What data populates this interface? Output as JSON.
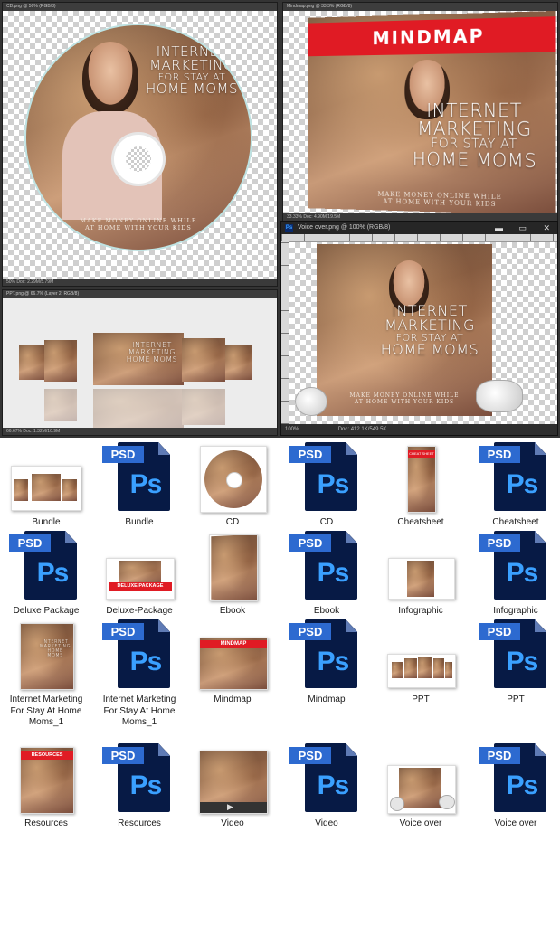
{
  "windows": {
    "cd": {
      "title": "CD.png @ 50% (RGB/8)",
      "status": "50%   Doc: 2.29M/5.79M"
    },
    "mindmap": {
      "title": "Mindmap.png @ 33.3% (RGB/8)",
      "status": "33.33%   Doc: 4.90M/19.5M"
    },
    "bundle": {
      "title": "PPT.png @ 66.7% (Layer 2, RGB/8)",
      "status": "66.67%   Doc: 1.32M/10.9M"
    },
    "voice": {
      "title": "Voice over.png @ 100% (RGB/8)",
      "zoom": "100%",
      "status": "Doc: 412.1K/549.5K"
    }
  },
  "artwork": {
    "title_line1": "INTERNET",
    "title_line2": "MARKETING",
    "title_line3": "FOR STAY AT",
    "title_line4": "HOME MOMS",
    "subtitle_line1": "MAKE MONEY ONLINE WHILE",
    "subtitle_line2": "AT HOME WITH YOUR KIDS",
    "banner_mindmap": "MINDMAP",
    "banner_cheatsheet": "CHEAT SHEET",
    "banner_deluxe": "DELUXE PACKAGE",
    "banner_resources": "RESOURCES"
  },
  "psd_tag": "PSD",
  "ps_glyph": "Ps",
  "files": [
    {
      "label": "Bundle",
      "kind": "bundle"
    },
    {
      "label": "Bundle",
      "kind": "psd"
    },
    {
      "label": "CD",
      "kind": "cd"
    },
    {
      "label": "CD",
      "kind": "psd"
    },
    {
      "label": "Cheatsheet",
      "kind": "cheatsheet"
    },
    {
      "label": "Cheatsheet",
      "kind": "psd"
    },
    {
      "label": "Deluxe Package",
      "kind": "psd"
    },
    {
      "label": "Deluxe-Package",
      "kind": "deluxe"
    },
    {
      "label": "Ebook",
      "kind": "ebook"
    },
    {
      "label": "Ebook",
      "kind": "psd"
    },
    {
      "label": "Infographic",
      "kind": "infographic"
    },
    {
      "label": "Infographic",
      "kind": "psd"
    },
    {
      "label": "Internet Marketing For Stay At Home Moms_1",
      "kind": "cover"
    },
    {
      "label": "Internet Marketing For Stay At Home Moms_1",
      "kind": "psd"
    },
    {
      "label": "Mindmap",
      "kind": "mindmap"
    },
    {
      "label": "Mindmap",
      "kind": "psd"
    },
    {
      "label": "PPT",
      "kind": "ppt"
    },
    {
      "label": "PPT",
      "kind": "psd"
    },
    {
      "label": "Resources",
      "kind": "resources"
    },
    {
      "label": "Resources",
      "kind": "psd"
    },
    {
      "label": "Video",
      "kind": "video"
    },
    {
      "label": "Video",
      "kind": "psd"
    },
    {
      "label": "Voice over",
      "kind": "voiceover"
    },
    {
      "label": "Voice over",
      "kind": "psd"
    }
  ],
  "colors": {
    "psd_dark": "#071a45",
    "psd_tag": "#2d6ad0",
    "ps_text": "#3aa0ff",
    "banner_red": "#e01b24"
  }
}
